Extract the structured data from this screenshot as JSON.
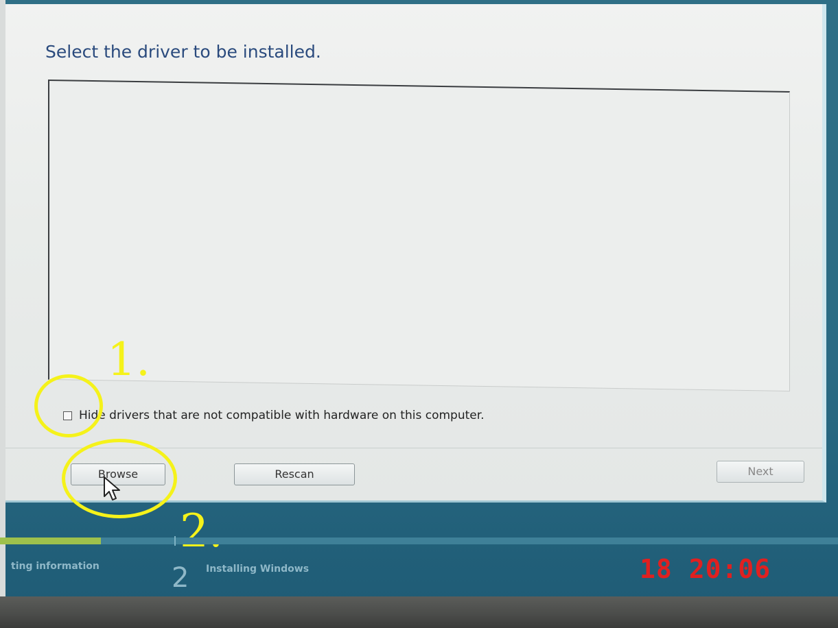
{
  "dialog": {
    "title": "Select the driver to be installed.",
    "hide_checkbox_label": "Hide drivers that are not compatible with hardware on this computer.",
    "hide_checkbox_checked": false,
    "buttons": {
      "browse": "Browse",
      "rescan": "Rescan",
      "next": "Next"
    }
  },
  "annotations": {
    "step_one": "1.",
    "step_two": "2."
  },
  "setup_progress": {
    "step_1_label": "ting information",
    "step_2_number": "2",
    "step_2_label": "Installing Windows",
    "fill_fraction": 0.12,
    "fill_color": "#9ec14c"
  },
  "camera_timestamp": {
    "day": "18",
    "time": "20:06",
    "color": "#e02020"
  },
  "colors": {
    "annotation": "#f5f21a",
    "title_text": "#2a4a7d"
  }
}
